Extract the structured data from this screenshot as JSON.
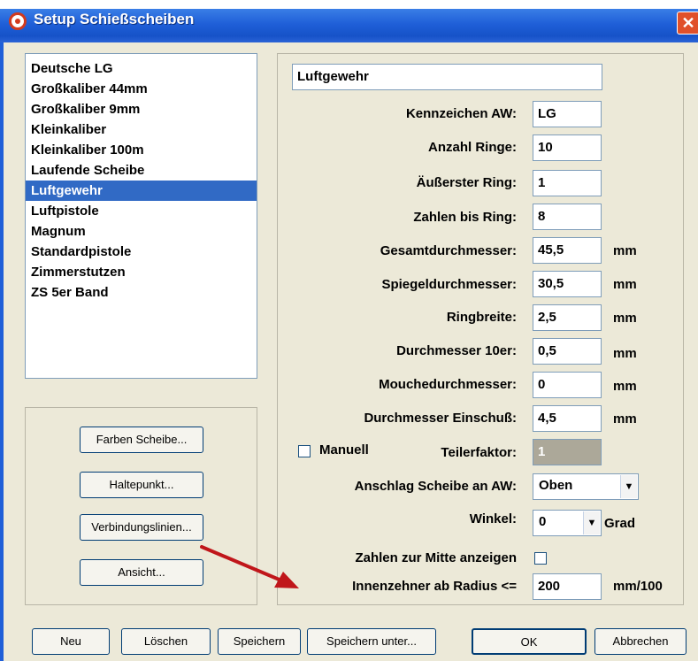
{
  "window": {
    "title": "Setup Schießscheiben",
    "close_glyph": "✕"
  },
  "targets": [
    "Deutsche LG",
    "Großkaliber 44mm",
    "Großkaliber 9mm",
    "Kleinkaliber",
    "Kleinkaliber 100m",
    "Laufende Scheibe",
    "Luftgewehr",
    "Luftpistole",
    "Magnum",
    "Standardpistole",
    "Zimmerstutzen",
    "ZS 5er Band"
  ],
  "selected_target": "Luftgewehr",
  "side_buttons": {
    "farben": "Farben Scheibe...",
    "haltepunkt": "Haltepunkt...",
    "verbindungslinien": "Verbindungslinien...",
    "ansicht": "Ansicht..."
  },
  "form": {
    "name": "Luftgewehr",
    "kennzeichen_label": "Kennzeichen AW:",
    "kennzeichen": "LG",
    "anzahl_label": "Anzahl Ringe:",
    "anzahl": "10",
    "aeusserster_label": "Äußerster Ring:",
    "aeusserster": "1",
    "zahlen_label": "Zahlen bis Ring:",
    "zahlen": "8",
    "gesamt_label": "Gesamtdurchmesser:",
    "gesamt": "45,5",
    "spiegel_label": "Spiegeldurchmesser:",
    "spiegel": "30,5",
    "ringbreite_label": "Ringbreite:",
    "ringbreite": "2,5",
    "zehner_label": "Durchmesser 10er:",
    "zehner": "0,5",
    "mouche_label": "Mouchedurchmesser:",
    "mouche": "0",
    "einschuss_label": "Durchmesser Einschuß:",
    "einschuss": "4,5",
    "manuell_label": "Manuell",
    "teiler_label": "Teilerfaktor:",
    "teiler": "1",
    "anschlag_label": "Anschlag Scheibe an AW:",
    "anschlag": "Oben",
    "winkel_label": "Winkel:",
    "winkel": "0",
    "grad_unit": "Grad",
    "mitte_label": "Zahlen zur Mitte anzeigen",
    "innen_label": "Innenzehner ab Radius <=",
    "innen": "200",
    "unit_mm": "mm",
    "unit_mm100": "mm/100"
  },
  "bottom_buttons": {
    "neu": "Neu",
    "loeschen": "Löschen",
    "speichern": "Speichern",
    "speichern_unter": "Speichern unter...",
    "ok": "OK",
    "abbrechen": "Abbrechen"
  },
  "colors": {
    "title_bar": "#1f5fd8",
    "selection": "#316ac5",
    "annotation_arrow": "#c0161a"
  }
}
